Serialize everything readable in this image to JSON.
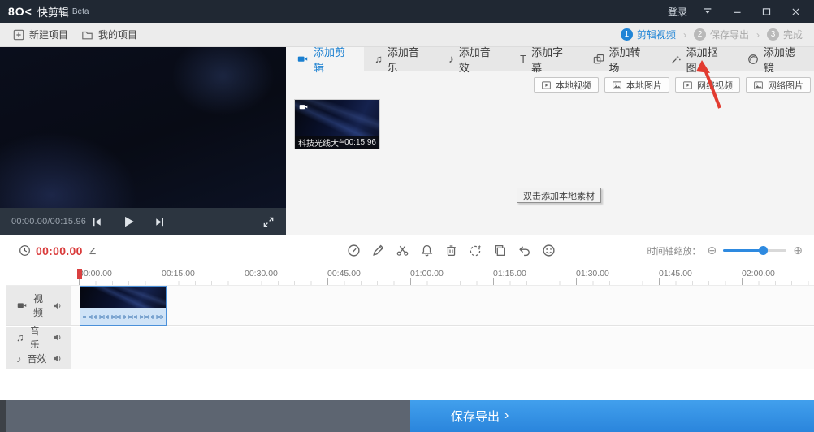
{
  "titlebar": {
    "logo": "8O<",
    "title": "快剪辑",
    "badge": "Beta",
    "login": "登录"
  },
  "projectbar": {
    "new_project": "新建项目",
    "my_projects": "我的项目",
    "separator": "›",
    "steps": [
      {
        "num": "1",
        "label": "剪辑视频"
      },
      {
        "num": "2",
        "label": "保存导出"
      },
      {
        "num": "3",
        "label": "完成"
      }
    ]
  },
  "preview": {
    "time": "00:00.00/00:15.96"
  },
  "tabs": {
    "items": [
      {
        "label": "添加剪辑"
      },
      {
        "label": "添加音乐"
      },
      {
        "label": "添加音效"
      },
      {
        "label": "添加字幕"
      },
      {
        "label": "添加转场"
      },
      {
        "label": "添加抠图"
      },
      {
        "label": "添加滤镜"
      }
    ]
  },
  "sources": {
    "items": [
      {
        "label": "本地视频"
      },
      {
        "label": "本地图片"
      },
      {
        "label": "网络视频"
      },
      {
        "label": "网络图片"
      }
    ]
  },
  "library": {
    "clip_name": "科技光线大气...",
    "clip_duration": "00:15.96",
    "tooltip": "双击添加本地素材"
  },
  "timeline": {
    "current_time": "00:00.00",
    "zoom_label": "时间轴缩放：",
    "ruler": [
      "00:00.00",
      "00:15.00",
      "00:30.00",
      "00:45.00",
      "01:00.00",
      "01:15.00",
      "01:30.00",
      "01:45.00",
      "02:00.00"
    ],
    "tracks": [
      {
        "label": "视频"
      },
      {
        "label": "音乐"
      },
      {
        "label": "音效"
      }
    ]
  },
  "export": {
    "label": "保存导出",
    "chevron": "›"
  },
  "icons": {
    "music": "♫",
    "sfx": "♪",
    "subtitle": "T",
    "zoom_out": "⊖",
    "zoom_in": "⊕"
  },
  "colors": {
    "accent": "#1f84d6",
    "time_red": "#d93a3a",
    "titlebar": "#202833",
    "export_blue": "#2f8de2"
  }
}
